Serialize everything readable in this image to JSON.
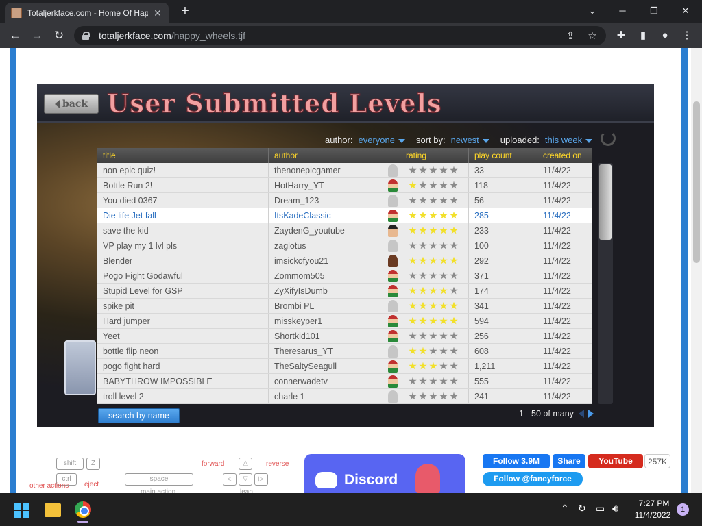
{
  "browser": {
    "tab_title": "Totaljerkface.com - Home Of Hap",
    "url_host": "totaljerkface.com",
    "url_path": "/happy_wheels.tjf",
    "window_controls": [
      "chevron-down-icon",
      "minimize-icon",
      "restore-icon",
      "close-icon"
    ]
  },
  "game": {
    "back_label": "back",
    "heading": "User Submitted Levels",
    "filters": [
      {
        "label": "author:",
        "value": "everyone"
      },
      {
        "label": "sort by:",
        "value": "newest"
      },
      {
        "label": "uploaded:",
        "value": "this week"
      }
    ],
    "columns": [
      "title",
      "author",
      "rating",
      "play count",
      "created on"
    ],
    "rows": [
      {
        "title": "non epic quiz!",
        "author": "thenonepicgamer",
        "avatar": "none",
        "stars": 0,
        "plays": "33",
        "date": "11/4/22"
      },
      {
        "title": "Bottle Run 2!",
        "author": "HotHarry_YT",
        "avatar": "face",
        "stars": 1,
        "plays": "118",
        "date": "11/4/22"
      },
      {
        "title": "You died  0367",
        "author": "Dream_123",
        "avatar": "none",
        "stars": 0,
        "plays": "56",
        "date": "11/4/22"
      },
      {
        "title": "Die life Jet fall",
        "author": "ItsKadeClassic",
        "avatar": "face",
        "stars": 4.5,
        "plays": "285",
        "date": "11/4/22",
        "highlight": true
      },
      {
        "title": "save the kid",
        "author": "ZaydenG_youtube",
        "avatar": "dark",
        "stars": 5,
        "plays": "233",
        "date": "11/4/22"
      },
      {
        "title": "VP play my 1 lvl pls",
        "author": "zaglotus",
        "avatar": "none",
        "stars": 0,
        "plays": "100",
        "date": "11/4/22"
      },
      {
        "title": "Blender",
        "author": "imsickofyou21",
        "avatar": "brown",
        "stars": 5,
        "plays": "292",
        "date": "11/4/22"
      },
      {
        "title": "Pogo Fight Godawful",
        "author": "Zommom505",
        "avatar": "face",
        "stars": 0,
        "plays": "371",
        "date": "11/4/22"
      },
      {
        "title": "Stupid Level for GSP",
        "author": "ZyXifyIsDumb",
        "avatar": "face",
        "stars": 4,
        "plays": "174",
        "date": "11/4/22"
      },
      {
        "title": "spike pit",
        "author": "Brombi PL",
        "avatar": "none",
        "stars": 5,
        "plays": "341",
        "date": "11/4/22"
      },
      {
        "title": "Hard jumper",
        "author": "misskeyper1",
        "avatar": "face",
        "stars": 4.5,
        "plays": "594",
        "date": "11/4/22"
      },
      {
        "title": "Yeet",
        "author": "Shortkid101",
        "avatar": "face",
        "stars": 0,
        "plays": "256",
        "date": "11/4/22"
      },
      {
        "title": "bottle flip neon",
        "author": "Theresarus_YT",
        "avatar": "none",
        "stars": 1.5,
        "plays": "608",
        "date": "11/4/22"
      },
      {
        "title": "pogo fight  hard",
        "author": "TheSaltySeagull",
        "avatar": "face",
        "stars": 3,
        "plays": "1,211",
        "date": "11/4/22"
      },
      {
        "title": "BABYTHROW IMPOSSIBLE",
        "author": "connerwadetv",
        "avatar": "face",
        "stars": 0,
        "plays": "555",
        "date": "11/4/22"
      },
      {
        "title": "troll level 2",
        "author": "charle 1",
        "avatar": "none",
        "stars": 0,
        "plays": "241",
        "date": "11/4/22"
      }
    ],
    "search_label": "search by name",
    "pager_text": "1 - 50 of many",
    "accent_color": "#5aa6ea",
    "heading_color": "#f2a0a0"
  },
  "controls": {
    "keys": [
      "shift",
      "Z",
      "ctrl",
      "space"
    ],
    "labels": {
      "other_actions": "other\nactions",
      "eject": "eject",
      "forward": "forward",
      "reverse": "reverse",
      "main_action": "main action",
      "lean": "lean"
    }
  },
  "social": {
    "discord": "Discord",
    "fb_follow": "Follow 3.9M",
    "fb_share": "Share",
    "youtube": "YouTube",
    "youtube_count": "257K",
    "twitter": "Follow @fancyforce"
  },
  "taskbar": {
    "time": "7:27 PM",
    "date": "11/4/2022",
    "notifications": "1"
  }
}
